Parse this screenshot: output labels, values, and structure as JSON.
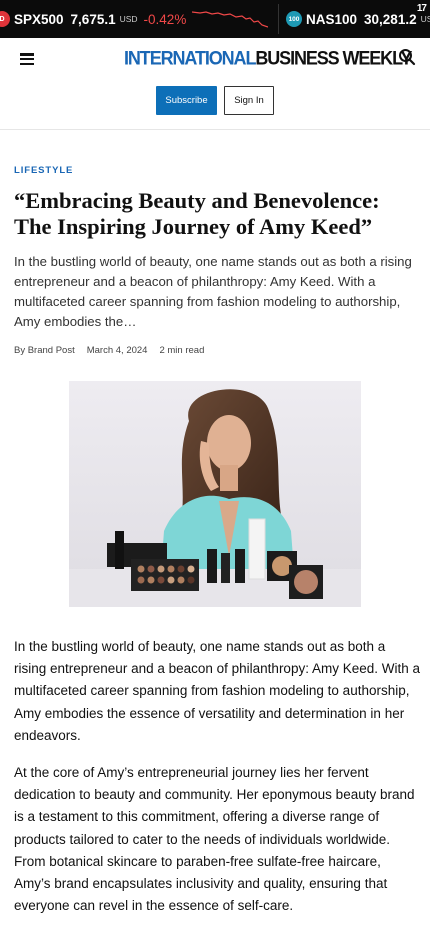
{
  "ticker": {
    "items": [
      {
        "badge": "D",
        "symbol": "SPX500",
        "value": "7,675.1",
        "currency": "USD",
        "change": "-0.42%"
      },
      {
        "badge": "100",
        "symbol": "NAS100",
        "value": "30,281.2",
        "currency": "USD",
        "change": ""
      }
    ],
    "logo": "17",
    "colors": {
      "negative": "#f04848",
      "background": "#0b0b0b"
    }
  },
  "header": {
    "logo_part1": "INTERNATIONAL",
    "logo_part2": "BUSINESS WEEKLY",
    "subscribe_label": "Subscribe",
    "signin_label": "Sign In",
    "brand_color": "#1a67b5"
  },
  "article": {
    "category": "LIFESTYLE",
    "title": "“Embracing Beauty and Benevolence: The Inspiring Journey of Amy Keed”",
    "dek": "In the bustling world of beauty, one name stands out as both a rising entrepreneur and a beacon of philanthropy: Amy Keed. With a multifaceted career spanning from fashion modeling to authorship, Amy embodies the…",
    "author": "By Brand Post",
    "date": "March 4, 2024",
    "read_time": "2 min read",
    "paragraphs": [
      "In the bustling world of beauty, one name stands out as both a rising entrepreneur and a beacon of philanthropy: Amy Keed. With a multifaceted career spanning from fashion modeling to authorship, Amy embodies the essence of versatility and determination in her endeavors.",
      "At the core of Amy’s entrepreneurial journey lies her fervent dedication to beauty and community. Her eponymous beauty brand is a testament to this commitment, offering a diverse range of products tailored to cater to the needs of individuals worldwide. From botanical skincare to paraben-free sulfate-free haircare, Amy’s brand encapsulates inclusivity and quality, ensuring that everyone can revel in the essence of self-care."
    ]
  }
}
